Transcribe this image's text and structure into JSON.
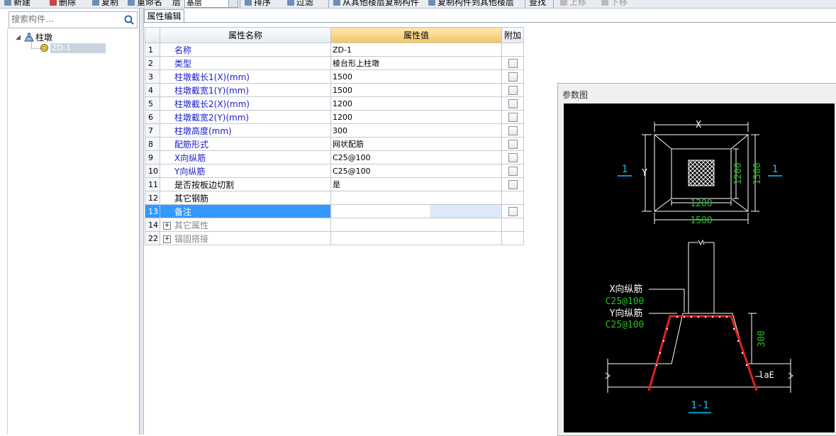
{
  "toolbar": {
    "items": [
      "新建",
      "删除",
      "复制",
      "重命名",
      "层",
      "排序",
      "过滤",
      "从其他楼层复制构件",
      "复制构件到其他楼层",
      "查找",
      "上移",
      "下移"
    ],
    "floor_value": "基层"
  },
  "search": {
    "placeholder": "搜索构件..."
  },
  "tree": {
    "root_label": "柱墩",
    "child_label": "ZD-1"
  },
  "tab": {
    "label": "属性编辑"
  },
  "grid": {
    "headers": {
      "name": "属性名称",
      "value": "属性值",
      "extra": "附加"
    },
    "rows": [
      {
        "n": "1",
        "name": "名称",
        "value": "ZD-1",
        "check": false,
        "style": "blue"
      },
      {
        "n": "2",
        "name": "类型",
        "value": "棱台形上柱墩",
        "check": true,
        "style": "blue"
      },
      {
        "n": "3",
        "name": "柱墩截长1(X)(mm)",
        "value": "1500",
        "check": true,
        "style": "blue"
      },
      {
        "n": "4",
        "name": "柱墩截宽1(Y)(mm)",
        "value": "1500",
        "check": true,
        "style": "blue"
      },
      {
        "n": "5",
        "name": "柱墩截长2(X)(mm)",
        "value": "1200",
        "check": true,
        "style": "blue"
      },
      {
        "n": "6",
        "name": "柱墩截宽2(Y)(mm)",
        "value": "1200",
        "check": true,
        "style": "blue"
      },
      {
        "n": "7",
        "name": "柱墩高度(mm)",
        "value": "300",
        "check": true,
        "style": "blue"
      },
      {
        "n": "8",
        "name": "配筋形式",
        "value": "网状配筋",
        "check": true,
        "style": "blue"
      },
      {
        "n": "9",
        "name": "X向纵筋",
        "value": "C25@100",
        "check": true,
        "style": "blue"
      },
      {
        "n": "10",
        "name": "Y向纵筋",
        "value": "C25@100",
        "check": true,
        "style": "blue"
      },
      {
        "n": "11",
        "name": "是否按板边切割",
        "value": "是",
        "check": true,
        "style": "black"
      },
      {
        "n": "12",
        "name": "其它钢筋",
        "value": "",
        "check": false,
        "style": "black"
      },
      {
        "n": "13",
        "name": "备注",
        "value": "",
        "check": true,
        "style": "selected"
      },
      {
        "n": "14",
        "name": "其它属性",
        "value": "",
        "check": false,
        "style": "gray",
        "expand": true
      },
      {
        "n": "22",
        "name": "锚固搭接",
        "value": "",
        "check": false,
        "style": "gray",
        "expand": true
      }
    ]
  },
  "param": {
    "title": "参数图",
    "plan": {
      "x_label": "X",
      "y_label": "Y",
      "inner_w": "1200",
      "inner_h": "1200",
      "outer_w": "1500",
      "outer_h": "1500",
      "section_left": "1",
      "section_right": "1"
    },
    "section": {
      "x_rebar_label": "X向纵筋",
      "x_rebar_value": "C25@100",
      "y_rebar_label": "Y向纵筋",
      "y_rebar_value": "C25@100",
      "height": "300",
      "anchor": "laE",
      "title": "1-1"
    }
  },
  "colors": {
    "selection": "#3399ff",
    "header_highlight": "#f3c55d",
    "name_text": "#1a1ad0",
    "cad_green": "#22c022",
    "cad_cyan": "#00c8ff",
    "rebar_red": "#e02020"
  }
}
